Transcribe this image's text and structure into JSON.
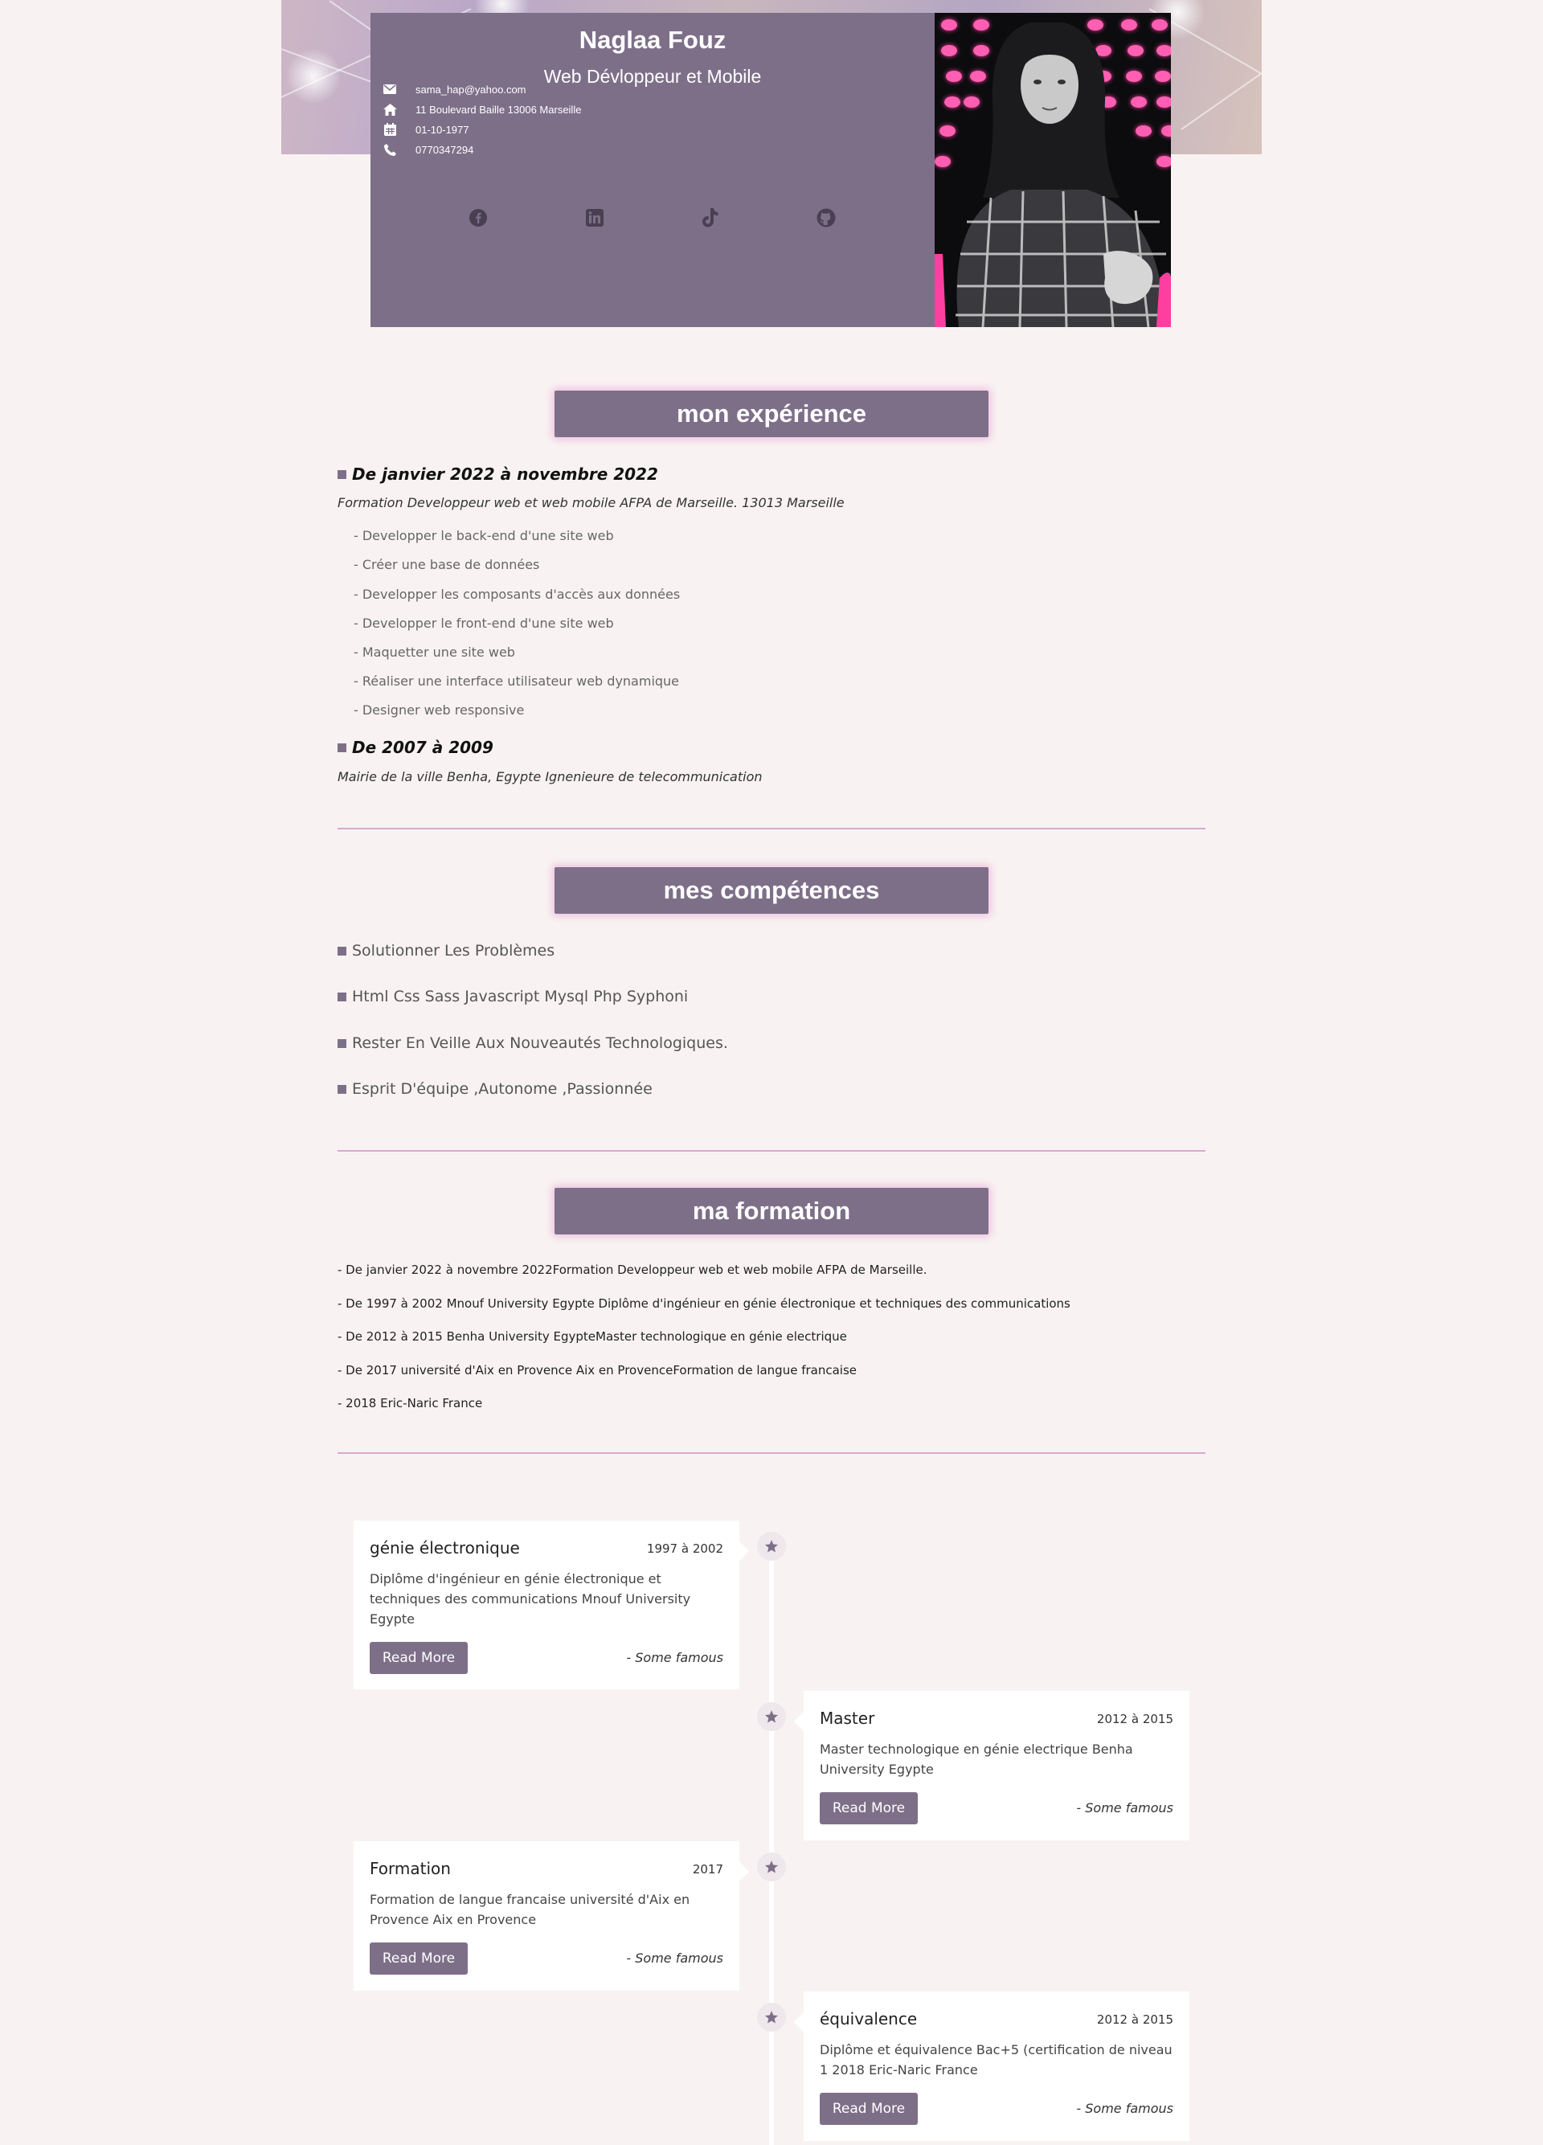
{
  "header": {
    "name": "Naglaa Fouz",
    "job_title": "Web Dévloppeur et Mobile",
    "contacts": [
      {
        "icon": "envelope-icon",
        "text": "sama_hap@yahoo.com"
      },
      {
        "icon": "home-icon",
        "text": "11 Boulevard Baille 13006 Marseille"
      },
      {
        "icon": "calendar-icon",
        "text": "01-10-1977"
      },
      {
        "icon": "phone-icon",
        "text": "0770347294"
      }
    ],
    "social": [
      "facebook-icon",
      "linkedin-icon",
      "tiktok-icon",
      "github-icon"
    ],
    "photo": "portrait-photo"
  },
  "experience": {
    "title": "mon expérience",
    "jobs": [
      {
        "period": "De janvier 2022 à novembre 2022",
        "org": "Formation Developpeur web et web mobile AFPA de Marseille. 13013 Marseille",
        "items": [
          "- Developper le back-end d'une site web",
          "- Créer une base de données",
          "- Developper les composants d'accès aux données",
          "- Developper le front-end d'une site web",
          "- Maquetter une site web",
          "- Réaliser une interface utilisateur web dynamique",
          "- Designer web responsive"
        ]
      },
      {
        "period": "De 2007 à 2009",
        "org": "Mairie de la ville Benha, Egypte Ignenieure de telecommunication",
        "items": []
      }
    ]
  },
  "skills": {
    "title": "mes compétences",
    "items": [
      "Solutionner Les Problèmes",
      "Html Css Sass Javascript Mysql Php Syphoni",
      "Rester En Veille Aux Nouveautés Technologiques.",
      "Esprit D'équipe ,Autonome ,Passionnée"
    ]
  },
  "education": {
    "title": "ma formation",
    "items": [
      "- De janvier 2022 à novembre 2022Formation Developpeur web et web mobile AFPA de Marseille.",
      "- De 1997 à 2002 Mnouf University Egypte Diplôme d'ingénieur en génie électronique et techniques des communications",
      "- De 2012 à 2015 Benha University EgypteMaster technologique en génie electrique",
      "- De 2017 université d'Aix en Provence Aix en ProvenceFormation de langue francaise",
      "- 2018 Eric-Naric France"
    ]
  },
  "timeline": [
    {
      "title": "génie électronique",
      "date": "1997 à 2002",
      "desc": "Diplôme d'ingénieur en génie électronique et techniques des communications Mnouf University Egypte",
      "button": "Read More",
      "quote": "- Some famous"
    },
    {
      "title": "Master",
      "date": "2012 à 2015",
      "desc": "Master technologique en génie electrique Benha University Egypte",
      "button": "Read More",
      "quote": "- Some famous"
    },
    {
      "title": "Formation",
      "date": "2017",
      "desc": "Formation de langue francaise université d'Aix en Provence Aix en Provence",
      "button": "Read More",
      "quote": "- Some famous"
    },
    {
      "title": "équivalence",
      "date": "2012 à 2015",
      "desc": "Diplôme et équivalence Bac+5 (certification de niveau 1 2018 Eric-Naric France",
      "button": "Read More",
      "quote": "- Some famous"
    }
  ],
  "colors": {
    "accent": "#7e6f89",
    "background": "#f8f3f2",
    "divider": "#d9a9cf",
    "glow": "#eb96d2"
  }
}
